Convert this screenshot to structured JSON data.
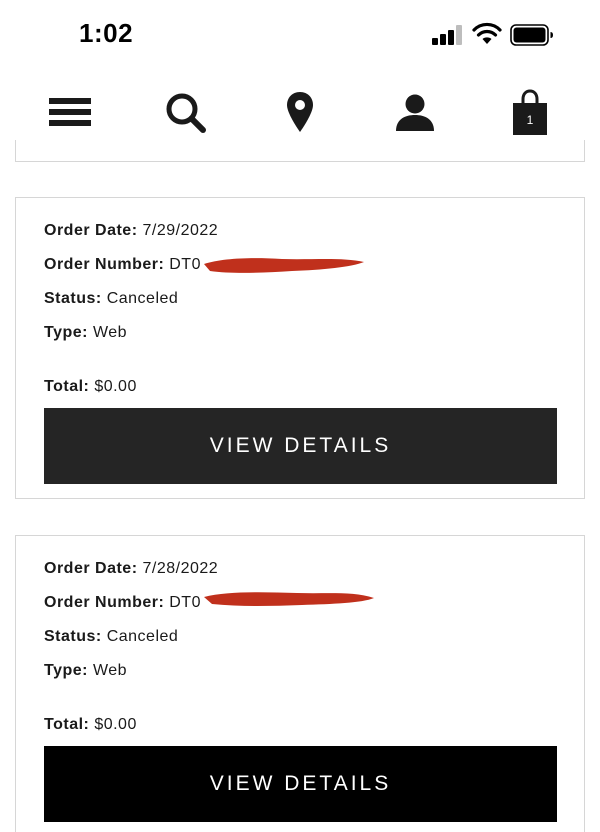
{
  "status_bar": {
    "time": "1:02"
  },
  "nav": {
    "icons": [
      "menu-icon",
      "search-icon",
      "location-pin-icon",
      "account-icon",
      "shopping-bag-icon"
    ],
    "cart_count": "1"
  },
  "orders": [
    {
      "date_label": "Order Date:",
      "date": "7/29/2022",
      "number_label": "Order Number:",
      "number_visible": "DT0",
      "status_label": "Status:",
      "status": "Canceled",
      "type_label": "Type:",
      "type": "Web",
      "total_label": "Total:",
      "total": "$0.00",
      "button_label": "VIEW DETAILS"
    },
    {
      "date_label": "Order Date:",
      "date": "7/28/2022",
      "number_label": "Order Number:",
      "number_visible": "DT0",
      "status_label": "Status:",
      "status": "Canceled",
      "type_label": "Type:",
      "type": "Web",
      "total_label": "Total:",
      "total": "$0.00",
      "button_label": "VIEW DETAILS"
    }
  ],
  "colors": {
    "button_bg_1": "#252525",
    "button_bg_2": "#000000",
    "redaction": "#c0301c",
    "card_border": "#d6d6d6"
  }
}
